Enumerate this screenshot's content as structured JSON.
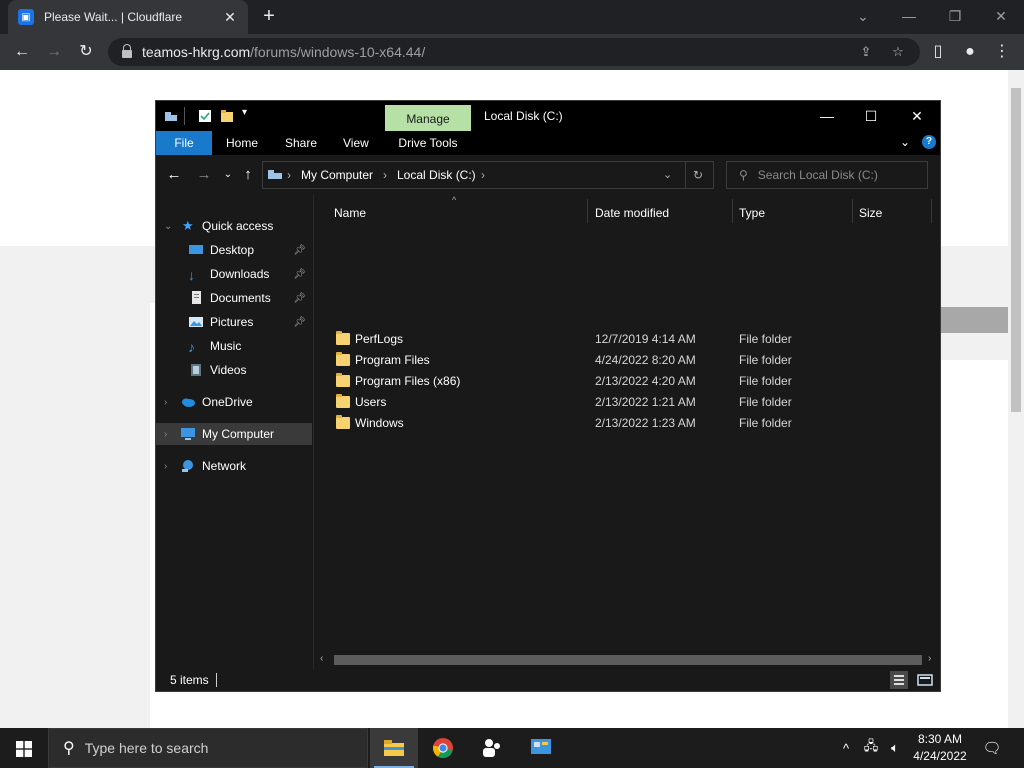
{
  "browser": {
    "tab_title": "Please Wait... | Cloudflare",
    "new_tab_symbol": "+",
    "url_host": "teamos-hkrg.com",
    "url_path": "/forums/windows-10-x64.44/"
  },
  "explorer": {
    "window_title": "Local Disk (C:)",
    "ribbon": {
      "contextual_group": "Manage",
      "tabs": [
        "File",
        "Home",
        "Share",
        "View",
        "Drive Tools"
      ]
    },
    "address": {
      "crumbs": [
        "My Computer",
        "Local Disk (C:)"
      ]
    },
    "search_placeholder": "Search Local Disk (C:)",
    "nav_pane": {
      "quick_access": "Quick access",
      "quick_items": [
        "Desktop",
        "Downloads",
        "Documents",
        "Pictures",
        "Music",
        "Videos"
      ],
      "onedrive": "OneDrive",
      "my_computer": "My Computer",
      "network": "Network"
    },
    "columns": [
      "Name",
      "Date modified",
      "Type",
      "Size"
    ],
    "rows": [
      {
        "name": "PerfLogs",
        "date": "12/7/2019 4:14 AM",
        "type": "File folder",
        "size": ""
      },
      {
        "name": "Program Files",
        "date": "4/24/2022 8:20 AM",
        "type": "File folder",
        "size": ""
      },
      {
        "name": "Program Files (x86)",
        "date": "2/13/2022 4:20 AM",
        "type": "File folder",
        "size": ""
      },
      {
        "name": "Users",
        "date": "2/13/2022 1:21 AM",
        "type": "File folder",
        "size": ""
      },
      {
        "name": "Windows",
        "date": "2/13/2022 1:23 AM",
        "type": "File folder",
        "size": ""
      }
    ],
    "status": "5 items"
  },
  "taskbar": {
    "search_text": "Type here to search",
    "time": "8:30 AM",
    "date": "4/24/2022"
  },
  "colors": {
    "manage_tab": "#b6e0a6",
    "file_tab": "#1979ca",
    "folder": "#f7d271"
  }
}
